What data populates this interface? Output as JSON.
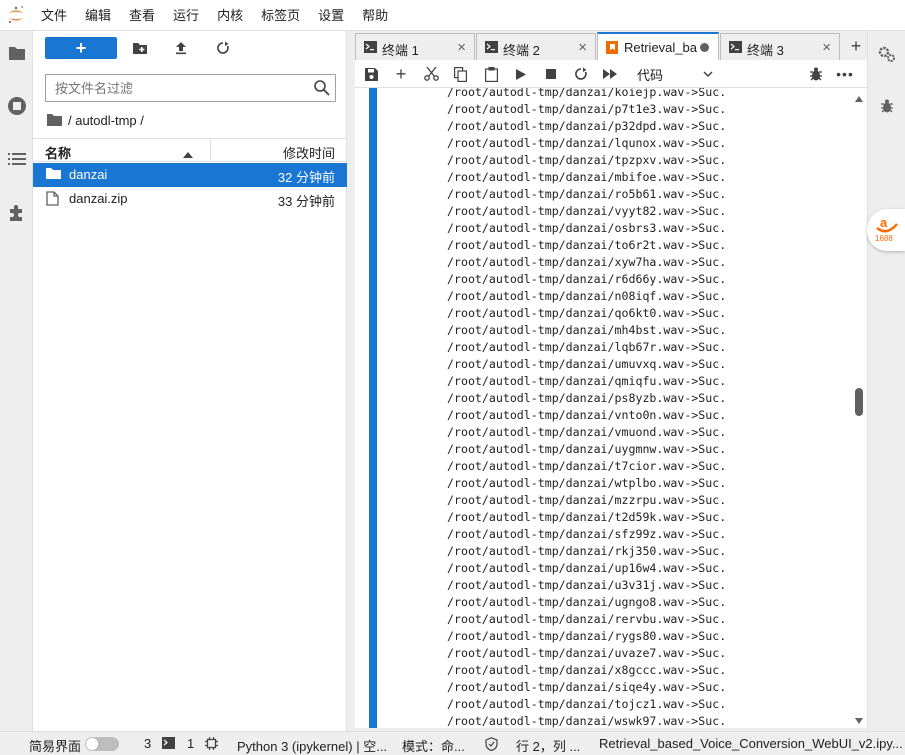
{
  "menubar": {
    "items": [
      "文件",
      "编辑",
      "查看",
      "运行",
      "内核",
      "标签页",
      "设置",
      "帮助"
    ]
  },
  "filebrowser": {
    "new_label": "+",
    "search_placeholder": "按文件名过滤",
    "path": "/ autodl-tmp /",
    "col_name": "名称",
    "col_modified": "修改时间",
    "files": [
      {
        "name": "danzai",
        "modified": "32 分钟前",
        "type": "folder"
      },
      {
        "name": "danzai.zip",
        "modified": "33 分钟前",
        "type": "file"
      }
    ]
  },
  "tabs": [
    {
      "label": "终端 1",
      "type": "terminal"
    },
    {
      "label": "终端 2",
      "type": "terminal"
    },
    {
      "label": "Retrieval_ba",
      "type": "notebook",
      "active": true
    },
    {
      "label": "终端 3",
      "type": "terminal"
    }
  ],
  "notebook_toolbar": {
    "cell_type": "代码"
  },
  "output_lines": [
    "/root/autodl-tmp/danzai/koiejp.wav->Suc.",
    "/root/autodl-tmp/danzai/p7t1e3.wav->Suc.",
    "/root/autodl-tmp/danzai/p32dpd.wav->Suc.",
    "/root/autodl-tmp/danzai/lqunox.wav->Suc.",
    "/root/autodl-tmp/danzai/tpzpxv.wav->Suc.",
    "/root/autodl-tmp/danzai/mbifoe.wav->Suc.",
    "/root/autodl-tmp/danzai/ro5b61.wav->Suc.",
    "/root/autodl-tmp/danzai/vyyt82.wav->Suc.",
    "/root/autodl-tmp/danzai/osbrs3.wav->Suc.",
    "/root/autodl-tmp/danzai/to6r2t.wav->Suc.",
    "/root/autodl-tmp/danzai/xyw7ha.wav->Suc.",
    "/root/autodl-tmp/danzai/r6d66y.wav->Suc.",
    "/root/autodl-tmp/danzai/n08iqf.wav->Suc.",
    "/root/autodl-tmp/danzai/qo6kt0.wav->Suc.",
    "/root/autodl-tmp/danzai/mh4bst.wav->Suc.",
    "/root/autodl-tmp/danzai/lqb67r.wav->Suc.",
    "/root/autodl-tmp/danzai/umuvxq.wav->Suc.",
    "/root/autodl-tmp/danzai/qmiqfu.wav->Suc.",
    "/root/autodl-tmp/danzai/ps8yzb.wav->Suc.",
    "/root/autodl-tmp/danzai/vnto0n.wav->Suc.",
    "/root/autodl-tmp/danzai/vmuond.wav->Suc.",
    "/root/autodl-tmp/danzai/uygmnw.wav->Suc.",
    "/root/autodl-tmp/danzai/t7cior.wav->Suc.",
    "/root/autodl-tmp/danzai/wtplbo.wav->Suc.",
    "/root/autodl-tmp/danzai/mzzrpu.wav->Suc.",
    "/root/autodl-tmp/danzai/t2d59k.wav->Suc.",
    "/root/autodl-tmp/danzai/sfz99z.wav->Suc.",
    "/root/autodl-tmp/danzai/rkj350.wav->Suc.",
    "/root/autodl-tmp/danzai/up16w4.wav->Suc.",
    "/root/autodl-tmp/danzai/u3v31j.wav->Suc.",
    "/root/autodl-tmp/danzai/ugngo8.wav->Suc.",
    "/root/autodl-tmp/danzai/rervbu.wav->Suc.",
    "/root/autodl-tmp/danzai/rygs80.wav->Suc.",
    "/root/autodl-tmp/danzai/uvaze7.wav->Suc.",
    "/root/autodl-tmp/danzai/x8gccc.wav->Suc.",
    "/root/autodl-tmp/danzai/siqe4y.wav->Suc.",
    "/root/autodl-tmp/danzai/tojcz1.wav->Suc.",
    "/root/autodl-tmp/danzai/wswk97.wav->Suc."
  ],
  "statusbar": {
    "simple_mode": "简易界面",
    "kernels_count": "3",
    "terminals_count": "1",
    "kernel": "Python 3 (ipykernel) | 空...",
    "mode": "模式：命...",
    "position": "行 2，列 ...",
    "filename": "Retrieval_based_Voice_Conversion_WebUI_v2.ipy..."
  },
  "badge_text": "1688",
  "colors": {
    "accent": "#1976d2",
    "logo_orange": "#f37726",
    "ali_orange": "#ff6a00",
    "notebook_tab_icon": "#ef6c00"
  }
}
